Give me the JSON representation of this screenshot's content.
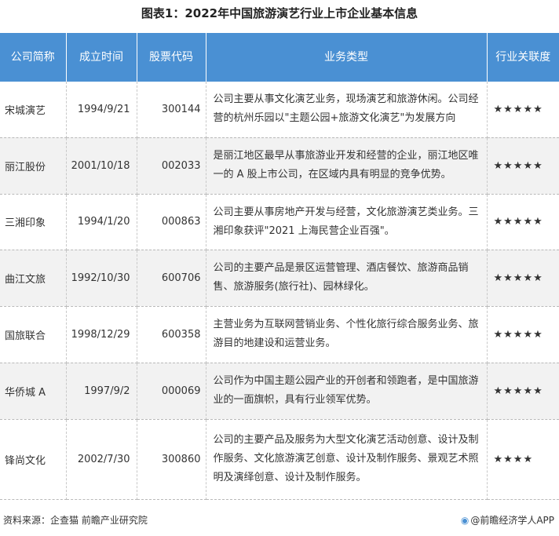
{
  "title": "图表1：2022年中国旅游演艺行业上市企业基本信息",
  "table": {
    "headers": [
      "公司简称",
      "成立时间",
      "股票代码",
      "业务类型",
      "行业关联度"
    ],
    "rows": [
      {
        "name": "宋城演艺",
        "date": "1994/9/21",
        "code": "300144",
        "desc": "公司主要从事文化演艺业务，现场演艺和旅游休闲。公司经营的杭州乐园以\"主题公园+旅游文化演艺\"为发展方向",
        "rating": "★★★★★"
      },
      {
        "name": "丽江股份",
        "date": "2001/10/18",
        "code": "002033",
        "desc": "是丽江地区最早从事旅游业开发和经营的企业，丽江地区唯一的 A 股上市公司，在区域内具有明显的竞争优势。",
        "rating": "★★★★★"
      },
      {
        "name": "三湘印象",
        "date": "1994/1/20",
        "code": "000863",
        "desc": "公司主要从事房地产开发与经营，文化旅游演艺类业务。三湘印象获评\"2021 上海民营企业百强\"。",
        "rating": "★★★★★"
      },
      {
        "name": "曲江文旅",
        "date": "1992/10/30",
        "code": "600706",
        "desc": "公司的主要产品是景区运营管理、酒店餐饮、旅游商品销售、旅游服务(旅行社)、园林绿化。",
        "rating": "★★★★★"
      },
      {
        "name": "国旅联合",
        "date": "1998/12/29",
        "code": "600358",
        "desc": "主营业务为互联网营销业务、个性化旅行综合服务业务、旅游目的地建设和运营业务。",
        "rating": "★★★★★"
      },
      {
        "name": "华侨城 A",
        "date": "1997/9/2",
        "code": "000069",
        "desc": "公司作为中国主题公园产业的开创者和领跑者，是中国旅游业的一面旗帜，具有行业领军优势。",
        "rating": "★★★★★"
      },
      {
        "name": "锋尚文化",
        "date": "2002/7/30",
        "code": "300860",
        "desc": "公司的主要产品及服务为大型文化演艺活动创意、设计及制作服务、文化旅游演艺创意、设计及制作服务、景观艺术照明及演绎创意、设计及制作服务。",
        "rating": "★★★★"
      }
    ]
  },
  "footer": {
    "source": "资料来源：企查猫 前瞻产业研究院",
    "brand": "@前瞻经济学人APP"
  },
  "colors": {
    "header_bg": "#4a90d3",
    "alt_row_bg": "#f2f2f2"
  }
}
